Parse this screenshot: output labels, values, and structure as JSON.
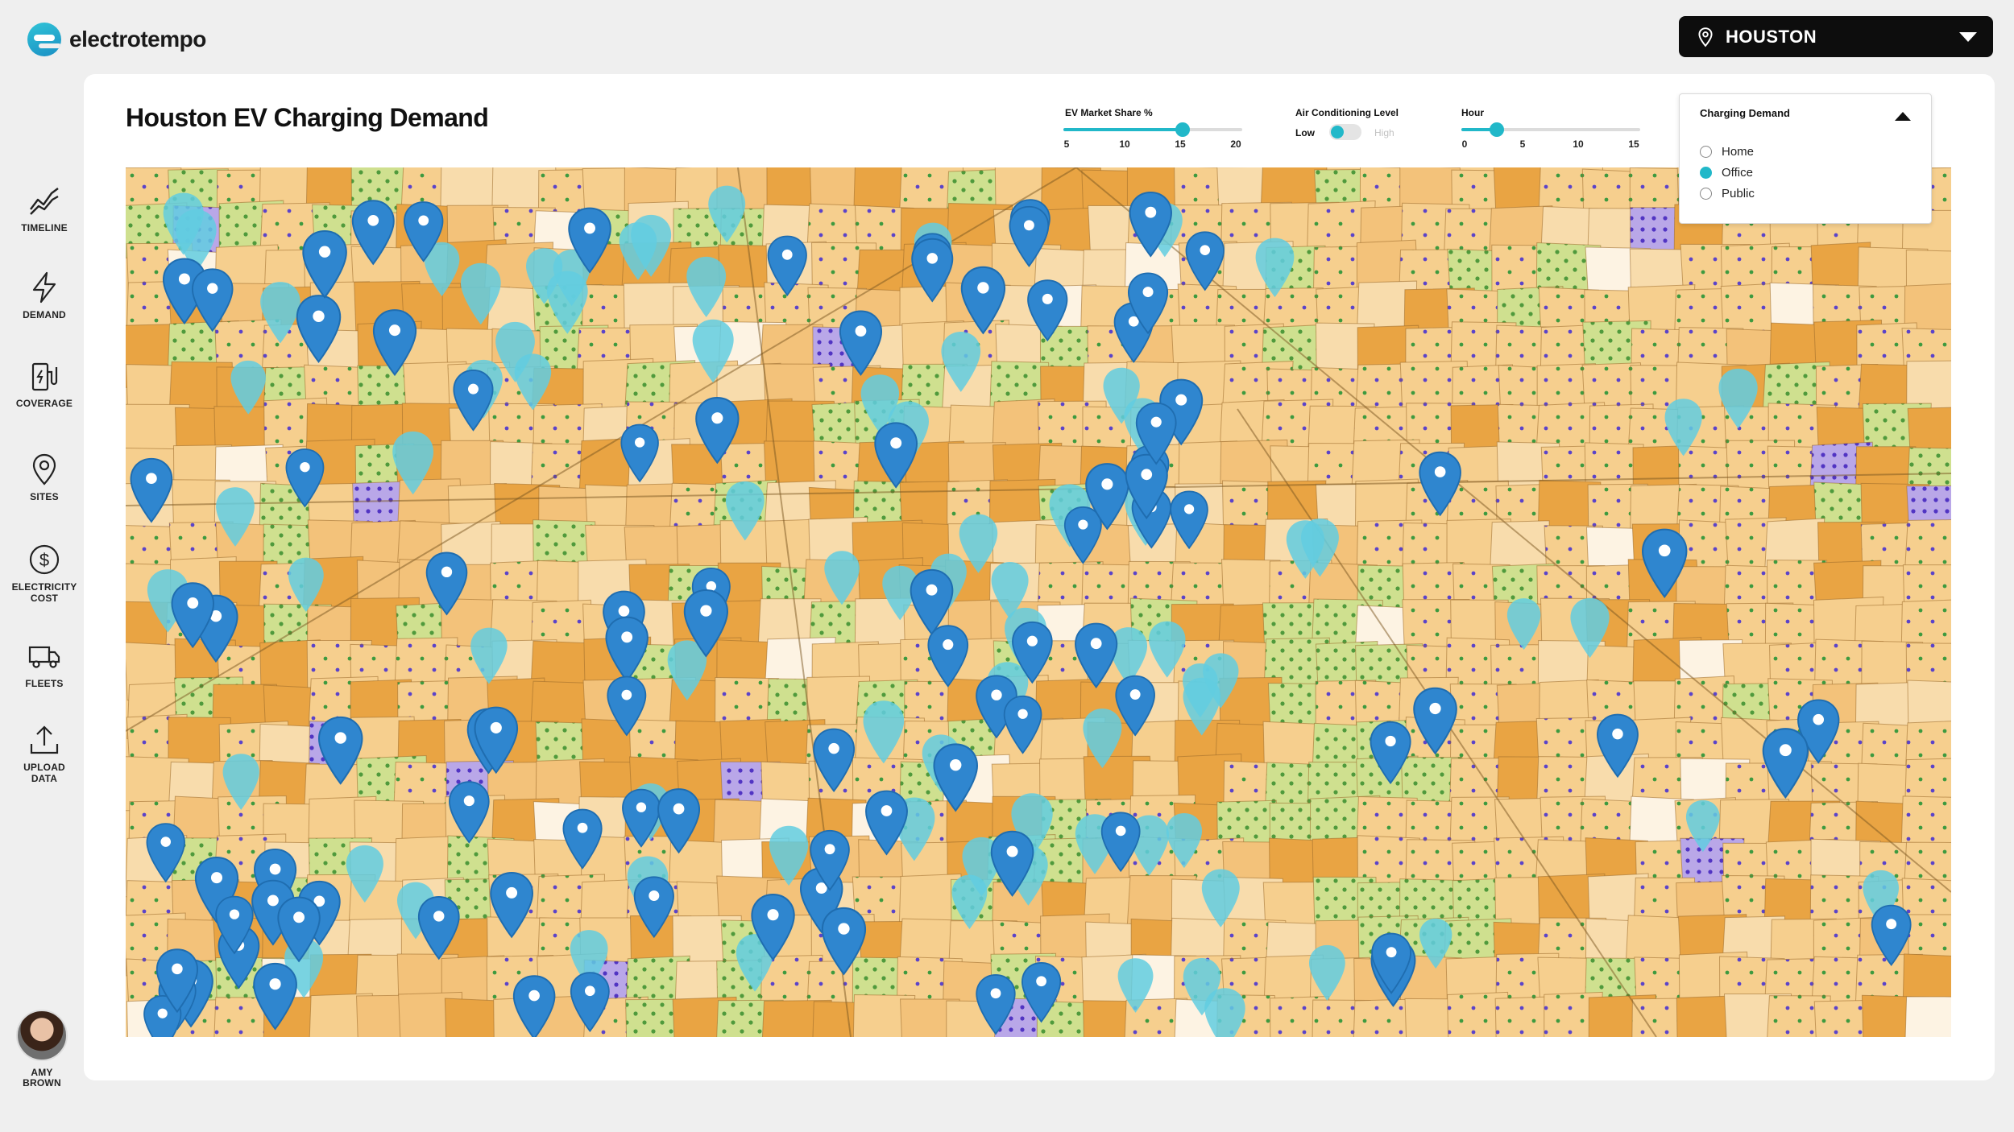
{
  "app": {
    "name": "electrotempo"
  },
  "header": {
    "city": "HOUSTON"
  },
  "sidebar": {
    "items": [
      {
        "label": "TIMELINE",
        "icon": "trend-line-icon"
      },
      {
        "label": "DEMAND",
        "icon": "lightning-icon"
      },
      {
        "label": "COVERAGE",
        "icon": "charger-icon"
      },
      {
        "label": "SITES",
        "icon": "location-pin-icon"
      },
      {
        "label": "ELECTRICITY\nCOST",
        "icon": "dollar-icon"
      },
      {
        "label": "FLEETS",
        "icon": "truck-icon"
      },
      {
        "label": "UPLOAD\nDATA",
        "icon": "upload-icon"
      }
    ],
    "user": {
      "name": "AMY\nBROWN"
    }
  },
  "main": {
    "title": "Houston EV Charging Demand",
    "controls": {
      "ev_share": {
        "title": "EV Market Share %",
        "ticks": [
          "5",
          "10",
          "15",
          "20"
        ],
        "value": 15,
        "min": 5,
        "max": 20
      },
      "ac_level": {
        "title": "Air Conditioning Level",
        "low": "Low",
        "high": "High",
        "value": "Low"
      },
      "hour": {
        "title": "Hour",
        "ticks": [
          "0",
          "5",
          "10",
          "15"
        ],
        "value": 3,
        "min": 0,
        "max": 15
      }
    },
    "charging_demand": {
      "title": "Charging Demand",
      "options": [
        "Home",
        "Office",
        "Public"
      ],
      "selected": "Office"
    }
  },
  "colors": {
    "accent": "#21b8c9",
    "pin_dark": "#2f86cf",
    "pin_light": "#62cde0",
    "map_light": "#f6cf8e",
    "map_dark": "#e9a443",
    "map_green": "#c9dc8b"
  }
}
